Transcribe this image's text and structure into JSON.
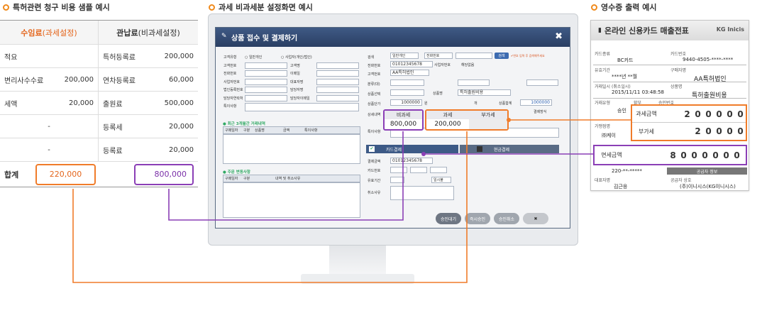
{
  "sections": {
    "fee_sample": "특허관련 청구 비용 샘플 예시",
    "tax_screen": "과세 비과세분 설정화면 예시",
    "receipt": "영수증 출력 예시"
  },
  "fee_table": {
    "col1_header_main": "수임료",
    "col1_header_sub": "(과세설정)",
    "col2_header_main": "관납료",
    "col2_header_sub": "(비과세설정)",
    "rows": [
      {
        "l": "적요",
        "lv": "",
        "r": "특허등록료",
        "rv": "200,000"
      },
      {
        "l": "변리사수수료",
        "lv": "200,000",
        "r": "연차등록료",
        "rv": "60,000"
      },
      {
        "l": "세액",
        "lv": "20,000",
        "r": "출원료",
        "rv": "500,000"
      },
      {
        "l": "-",
        "lv": "",
        "r": "등록세",
        "rv": "20,000"
      },
      {
        "l": "-",
        "lv": "",
        "r": "등록료",
        "rv": "20,000"
      }
    ],
    "total_label": "합계",
    "total_taxable": "220,000",
    "total_nontaxable": "800,000"
  },
  "window": {
    "title": "상품 접수 및 결제하기",
    "left_labels": [
      "고객유형",
      "고객번호",
      "전화번호",
      "사업자번호",
      "법인등록번호",
      "담당자연락처",
      "특이사항"
    ],
    "customer_type_opt1": "○ 일반개인",
    "customer_type_opt2": "○ 사업자(개인/법인)",
    "mid_labels": [
      "고객명",
      "이메일",
      "대표자명",
      "담당자명",
      "담당자이메일"
    ],
    "recent_header": "최근 3개월간 거래내역",
    "recent_cols": [
      "구매일자",
      "구분",
      "상품명",
      "금액",
      "특이사항"
    ],
    "order_header": "주문 변동사항",
    "order_cols": [
      "구매일자",
      "구분",
      "내역 및 취소사유"
    ],
    "right_labels": [
      "검색",
      "전화번호",
      "고객번호",
      "분류(대)",
      "분류(소)",
      "상품선택",
      "상품단가",
      "상세내역",
      "특이사항"
    ],
    "search_type": "일반개인",
    "search_sel2": "전화번호",
    "search_btn": "검색",
    "search_note": "✔번호 입력 후 검색해주세요",
    "phone": "01012345678",
    "business_label": "사업자번호",
    "business_val": "해당없음",
    "customer_name": "AA특허법인",
    "product_name_label": "상품명",
    "product_name": "특허출원비용",
    "unit_price": "1000000",
    "unit_won": "원",
    "qty_label": "개",
    "sum_label": "상품합계",
    "sum_val": "1000000",
    "pay_method": "결제방식",
    "nontax_label": "비과세",
    "nontax_val": "800,000",
    "tax_label": "과세",
    "tax_val": "200,000",
    "vat_label": "부가세",
    "card_pay": "카드결제",
    "cash_pay": "현금결제",
    "pay_amount_label": "결제금액",
    "card_phone": "01012345678",
    "card_no_label": "카드번호",
    "valid_label": "유효기간",
    "cancel_label": "취소사유",
    "installment": "일시불",
    "buttons": [
      "승인대기",
      "즉시승인",
      "승인취소",
      "✖"
    ]
  },
  "receipt": {
    "title": "온라인 신용카드 매출전표",
    "logo": "KG Inicis",
    "card_type_label": "카드종류",
    "card_type": "BC카드",
    "card_no_label": "카드번호",
    "card_no": "9440-4505-****-****",
    "valid_label": "유효기간",
    "valid": "****년 **월",
    "buyer_label": "구매자명",
    "buyer": "AA특허법인",
    "date_label": "거래일시 (취소일시)",
    "date": "2015/11/11  03:48:58",
    "product_label": "상품명",
    "product": "특허출원비용",
    "type_label": "거래유형",
    "approve": "승인",
    "install_label": "할부",
    "approval_no_label": "승인번호",
    "merchant_label": "가맹점명",
    "merchant": "㈜케이",
    "taxable_label": "과세금액",
    "taxable_digits": [
      "",
      "",
      "2",
      "0",
      "0",
      "0",
      "0",
      "0"
    ],
    "vat_label": "부가세",
    "vat_digits": [
      "",
      "",
      "",
      "2",
      "0",
      "0",
      "0",
      "0"
    ],
    "exempt_label": "면세금액",
    "exempt_digits": [
      "",
      "8",
      "0",
      "0",
      "0",
      "0",
      "0",
      "0"
    ],
    "biz_no": "220-**-*****",
    "supplier_bar": "공급자 정보",
    "ceo_label": "대표자명",
    "ceo": "김근응",
    "supplier_label": "공급자 상호",
    "supplier": "(주)이니시스(KG이니시스)"
  },
  "colors": {
    "orange": "#f07c2a",
    "purple": "#8b3fb6",
    "window_title": "#2f4870"
  }
}
